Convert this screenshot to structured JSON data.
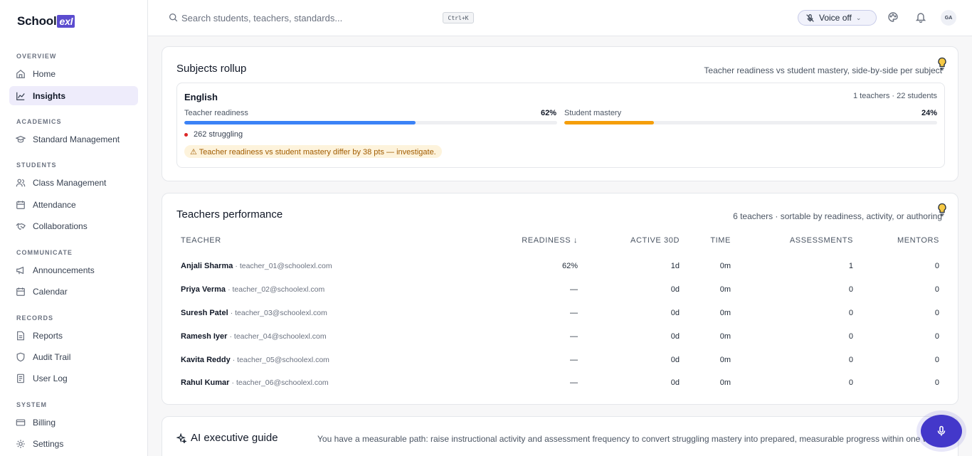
{
  "app": {
    "name": "School",
    "name_badge": "exl"
  },
  "sidebar": {
    "sections": [
      {
        "label": "OVERVIEW",
        "items": [
          {
            "label": "Home",
            "icon": "home-icon"
          },
          {
            "label": "Insights",
            "icon": "chart-icon",
            "active": true
          }
        ]
      },
      {
        "label": "ACADEMICS",
        "items": [
          {
            "label": "Standard Management",
            "icon": "graduation-cap-icon"
          }
        ]
      },
      {
        "label": "STUDENTS",
        "items": [
          {
            "label": "Class Management",
            "icon": "users-icon"
          },
          {
            "label": "Attendance",
            "icon": "calendar-icon"
          },
          {
            "label": "Collaborations",
            "icon": "handshake-icon"
          }
        ]
      },
      {
        "label": "COMMUNICATE",
        "items": [
          {
            "label": "Announcements",
            "icon": "megaphone-icon"
          },
          {
            "label": "Calendar",
            "icon": "calendar-icon"
          }
        ]
      },
      {
        "label": "RECORDS",
        "items": [
          {
            "label": "Reports",
            "icon": "file-icon"
          },
          {
            "label": "Audit Trail",
            "icon": "shield-icon"
          },
          {
            "label": "User Log",
            "icon": "log-icon"
          }
        ]
      },
      {
        "label": "SYSTEM",
        "items": [
          {
            "label": "Billing",
            "icon": "card-icon"
          },
          {
            "label": "Settings",
            "icon": "gear-icon"
          }
        ]
      }
    ]
  },
  "topbar": {
    "search_placeholder": "Search students, teachers, standards...",
    "shortcut": "Ctrl+K",
    "voice_label": "Voice off",
    "avatar_initials": "GA"
  },
  "subjects": {
    "title": "Subjects rollup",
    "subtitle": "Teacher readiness vs student mastery, side-by-side per subject",
    "items": [
      {
        "name": "English",
        "meta": "1 teachers · 22 students",
        "teacher_label": "Teacher readiness",
        "teacher_value": "62%",
        "teacher_pct": 62,
        "student_label": "Student mastery",
        "student_value": "24%",
        "student_pct": 24,
        "struggling": "262 struggling",
        "warning": "⚠ Teacher readiness vs student mastery differ by 38 pts — investigate."
      }
    ]
  },
  "teachers": {
    "title": "Teachers performance",
    "subtitle": "6 teachers · sortable by readiness, activity, or authoring",
    "columns": [
      "TEACHER",
      "READINESS ↓",
      "ACTIVE 30D",
      "TIME",
      "ASSESSMENTS",
      "MENTORS"
    ],
    "rows": [
      {
        "name": "Anjali Sharma",
        "email": "· teacher_01@schoolexl.com",
        "readiness": "62%",
        "active": "1d",
        "time": "0m",
        "assessments": "1",
        "mentors": "0"
      },
      {
        "name": "Priya Verma",
        "email": "· teacher_02@schoolexl.com",
        "readiness": "—",
        "active": "0d",
        "time": "0m",
        "assessments": "0",
        "mentors": "0"
      },
      {
        "name": "Suresh Patel",
        "email": "· teacher_03@schoolexl.com",
        "readiness": "—",
        "active": "0d",
        "time": "0m",
        "assessments": "0",
        "mentors": "0"
      },
      {
        "name": "Ramesh Iyer",
        "email": "· teacher_04@schoolexl.com",
        "readiness": "—",
        "active": "0d",
        "time": "0m",
        "assessments": "0",
        "mentors": "0"
      },
      {
        "name": "Kavita Reddy",
        "email": "· teacher_05@schoolexl.com",
        "readiness": "—",
        "active": "0d",
        "time": "0m",
        "assessments": "0",
        "mentors": "0"
      },
      {
        "name": "Rahul Kumar",
        "email": "· teacher_06@schoolexl.com",
        "readiness": "—",
        "active": "0d",
        "time": "0m",
        "assessments": "0",
        "mentors": "0"
      }
    ]
  },
  "ai_guide": {
    "title": "AI executive guide",
    "text": "You have a measurable path: raise instructional activity and assessment frequency to convert struggling mastery into prepared, measurable progress within one week."
  },
  "colors": {
    "accent": "#5b4ccf",
    "teacher_bar": "#3b82f6",
    "student_bar": "#f59e0b",
    "fab": "#4338ca"
  }
}
